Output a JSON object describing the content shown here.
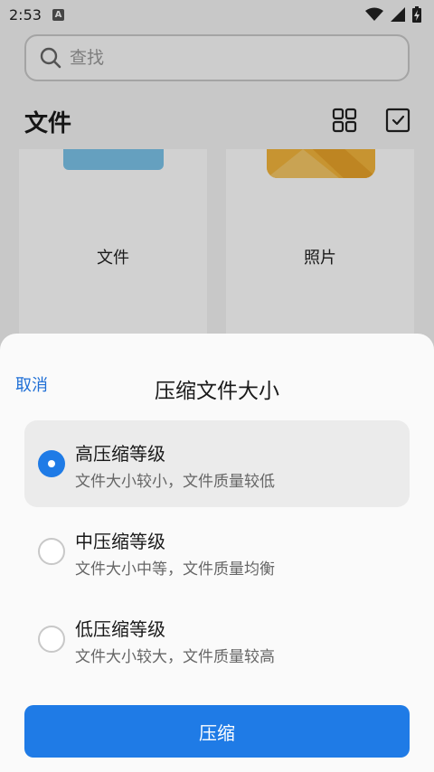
{
  "status_bar": {
    "time": "2:53",
    "notification_letter": "A",
    "icons": [
      "wifi-icon",
      "cell-signal-icon",
      "battery-charging-icon"
    ]
  },
  "search": {
    "placeholder": "查找",
    "value": ""
  },
  "header": {
    "title": "文件"
  },
  "categories": [
    {
      "label": "文件",
      "icon": "file-folder-thumb"
    },
    {
      "label": "照片",
      "icon": "photo-folder-thumb"
    }
  ],
  "sheet": {
    "cancel_label": "取消",
    "title": "压缩文件大小",
    "options": [
      {
        "title": "高压缩等级",
        "desc": "文件大小较小，文件质量较低",
        "selected": true
      },
      {
        "title": "中压缩等级",
        "desc": "文件大小中等，文件质量均衡",
        "selected": false
      },
      {
        "title": "低压缩等级",
        "desc": "文件大小较大，文件质量较高",
        "selected": false
      }
    ],
    "confirm_label": "压缩"
  },
  "colors": {
    "accent": "#1f7be6",
    "link": "#1f6fd6",
    "selected_row": "#ebebeb",
    "file_thumb": "#7cc4ea",
    "photo_thumb": "#f3b53c"
  }
}
